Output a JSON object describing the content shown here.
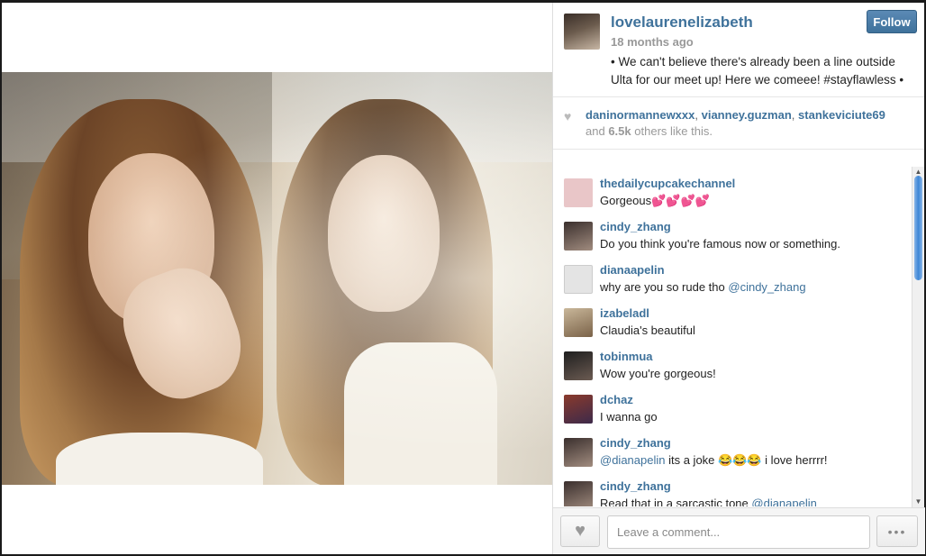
{
  "post": {
    "username": "lovelaurenelizabeth",
    "timestamp": "18 months ago",
    "follow_label": "Follow",
    "caption": "• We can't believe there's already been a line outside Ulta for our meet up! Here we comeee! #stayflawless •"
  },
  "likes": {
    "likers": [
      "daninormannewxxx",
      "vianney.guzman",
      "stankeviciute69"
    ],
    "and_text": "and",
    "count": "6.5k",
    "others_text": "others like this."
  },
  "comments": [
    {
      "user": "thedailycupcakechannel",
      "text": "Gorgeous💕💕💕💕",
      "avatar_color": "#e9c6c8"
    },
    {
      "user": "cindy_zhang",
      "text": "Do you think you're famous now or something.",
      "avatar_color": "#3a2f2d"
    },
    {
      "user": "dianaapelin",
      "text": "why are you so rude tho",
      "mention": "@cindy_zhang",
      "avatar_color": "#d9d9d9"
    },
    {
      "user": "izabeladl",
      "text": "Claudia's beautiful",
      "avatar_color": "#a58e70"
    },
    {
      "user": "tobinmua",
      "text": "Wow you're gorgeous!",
      "avatar_color": "#2b2b2b"
    },
    {
      "user": "dchaz",
      "text": "I wanna go",
      "avatar_color": "#5b3a2c"
    },
    {
      "user": "cindy_zhang",
      "mention_prefix": "@dianapelin",
      "text": " its a joke 😂😂😂 i love herrrr!",
      "avatar_color": "#3a2f2d"
    },
    {
      "user": "cindy_zhang",
      "text": "Read that in a sarcastic tone",
      "mention": "@dianapelin",
      "avatar_color": "#3a2f2d"
    }
  ],
  "footer": {
    "comment_placeholder": "Leave a comment...",
    "more_label": "•••"
  },
  "icons": {
    "heart": "♥",
    "scroll_up": "▲",
    "scroll_down": "▼"
  }
}
